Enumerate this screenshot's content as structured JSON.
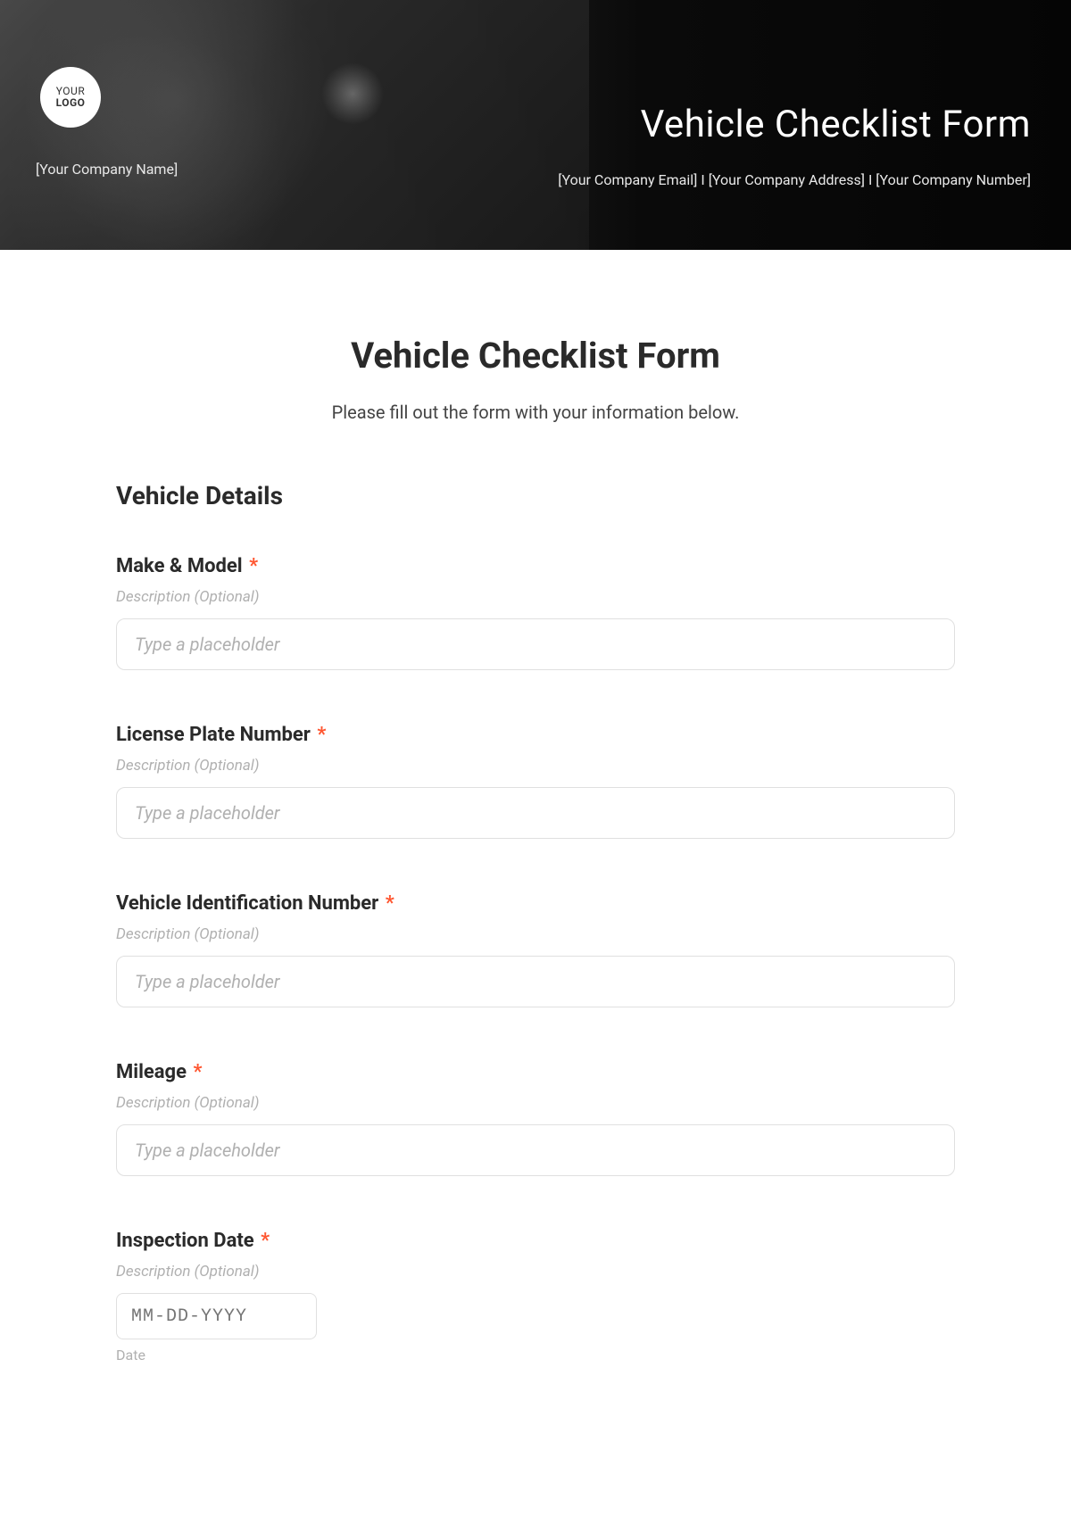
{
  "header": {
    "logo": {
      "line1": "YOUR",
      "line2": "LOGO"
    },
    "companyName": "[Your Company Name]",
    "title": "Vehicle Checklist Form",
    "contactInfo": "[Your Company Email] I [Your Company Address] I [Your Company Number]"
  },
  "form": {
    "title": "Vehicle Checklist Form",
    "subtitle": "Please fill out the form with your information below.",
    "section": {
      "title": "Vehicle Details"
    },
    "fields": {
      "makeModel": {
        "label": "Make & Model",
        "required": "*",
        "description": "Description (Optional)",
        "placeholder": "Type a placeholder"
      },
      "licensePlate": {
        "label": "License Plate Number",
        "required": "*",
        "description": "Description (Optional)",
        "placeholder": "Type a placeholder"
      },
      "vin": {
        "label": "Vehicle Identification Number",
        "required": "*",
        "description": "Description (Optional)",
        "placeholder": "Type a placeholder"
      },
      "mileage": {
        "label": "Mileage",
        "required": "*",
        "description": "Description (Optional)",
        "placeholder": "Type a placeholder"
      },
      "inspectionDate": {
        "label": "Inspection Date",
        "required": "*",
        "description": "Description (Optional)",
        "placeholder": "MM-DD-YYYY",
        "sublabel": "Date"
      }
    }
  }
}
